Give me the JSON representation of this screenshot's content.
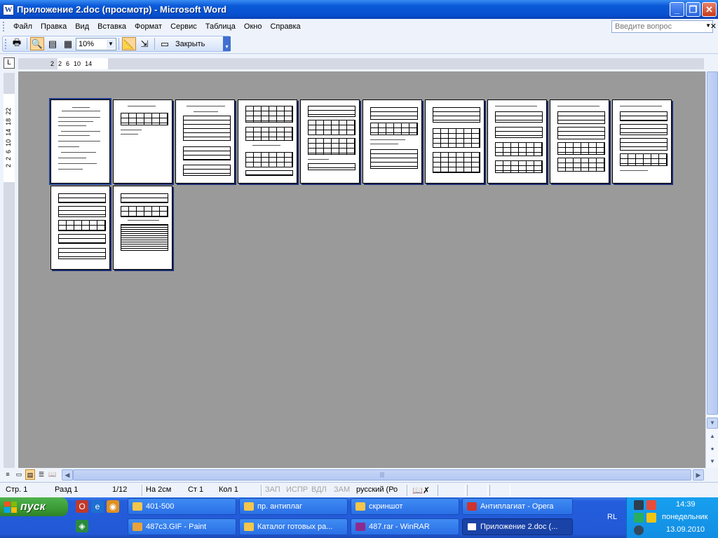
{
  "window": {
    "title": "Приложение 2.doc (просмотр) - Microsoft Word",
    "app_icon": "W",
    "controls": [
      "minimize-icon",
      "maximize-icon",
      "close-icon"
    ]
  },
  "menu": {
    "items": [
      "Файл",
      "Правка",
      "Вид",
      "Вставка",
      "Формат",
      "Сервис",
      "Таблица",
      "Окно",
      "Справка"
    ],
    "help_placeholder": "Введите вопрос"
  },
  "toolbar": {
    "zoom": "10%",
    "close_label": "Закрыть",
    "buttons": [
      "print-icon",
      "magnifier-icon",
      "one-page-icon",
      "multiple-pages-icon",
      "zoom-combo",
      "view-ruler-icon",
      "shrink-to-fit-icon",
      "full-screen-icon",
      "close-preview-button"
    ]
  },
  "ruler": {
    "corner": "L",
    "h_ticks": [
      "2",
      "2",
      "6",
      "10",
      "14"
    ],
    "v_ticks": [
      "2",
      "2",
      "6",
      "10",
      "14",
      "18",
      "22"
    ]
  },
  "pages": {
    "count": 12
  },
  "status": {
    "page": "Стр. 1",
    "section": "Разд 1",
    "page_of": "1/12",
    "at": "На 2см",
    "line": "Ст 1",
    "col": "Кол 1",
    "rec": "ЗАП",
    "trk": "ИСПР",
    "ext": "ВДЛ",
    "ovr": "ЗАМ",
    "lang": "русский (Ро"
  },
  "taskbar": {
    "start_label": "пуск",
    "tasks_row1": [
      "401-500",
      "пр. антиплаг",
      "скриншот",
      "Антиплагиат - Opera"
    ],
    "tasks_row2": [
      "487c3.GIF - Paint",
      "Каталог готовых ра...",
      "487.rar - WinRAR",
      "Приложение 2.doc (..."
    ],
    "lang": "RL",
    "time": "14:39",
    "day": "понедельник",
    "date": "13.09.2010"
  },
  "colors": {
    "title_blue": "#0a5ad8",
    "canvas_gray": "#9a9a9a",
    "start_green": "#3a9a33",
    "tray_blue": "#128ee3"
  }
}
